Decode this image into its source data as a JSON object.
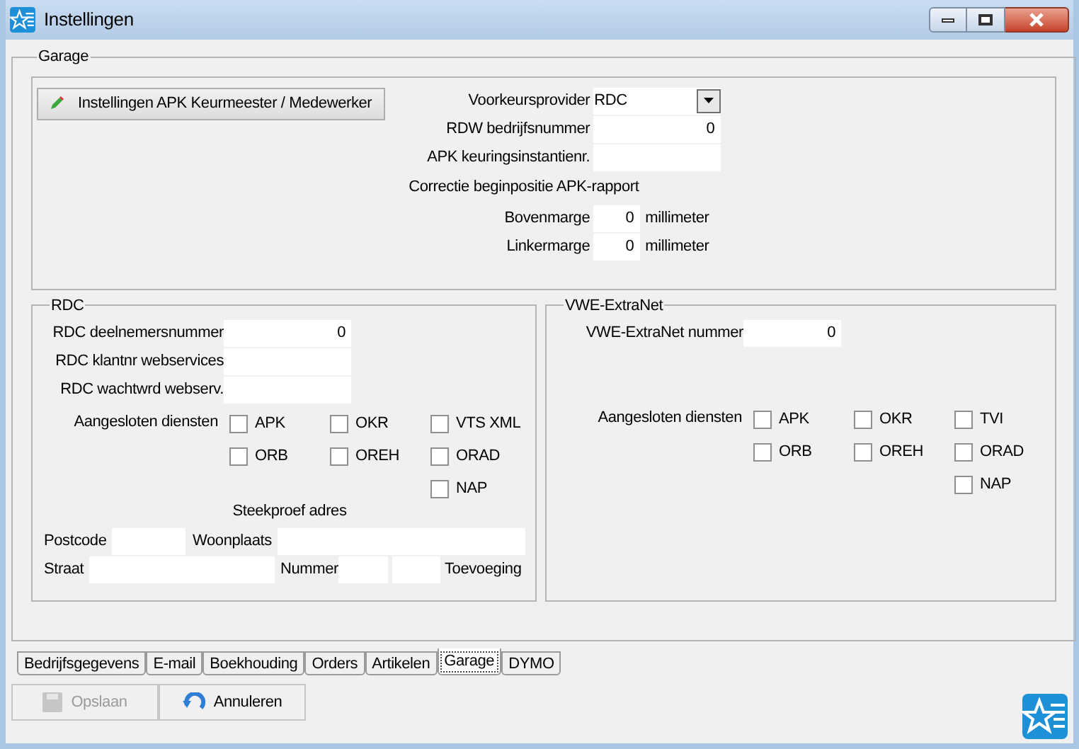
{
  "window": {
    "title": "Instellingen"
  },
  "garage": {
    "title": "Garage",
    "button": "Instellingen APK Keurmeester / Medewerker",
    "provider": {
      "label": "Voorkeursprovider",
      "value": "RDC"
    },
    "fields": [
      {
        "label": "RDW bedrijfsnummer",
        "value": "0"
      },
      {
        "label": "APK keuringsinstantienr."
      }
    ],
    "correction_heading": "Correctie beginpositie APK-rapport",
    "margins": [
      {
        "label": "Bovenmarge",
        "value": "0",
        "unit": "millimeter"
      },
      {
        "label": "Linkermarge",
        "value": "0",
        "unit": "millimeter"
      }
    ]
  },
  "rdc": {
    "title": "RDC",
    "fields": [
      {
        "label": "RDC deelnemersnummer",
        "value": "0"
      },
      {
        "label": "RDC klantnr webservices"
      },
      {
        "label": "RDC wachtwrd webserv."
      }
    ],
    "services_label": "Aangesloten diensten",
    "services": [
      [
        {
          "label": "APK",
          "checked": false
        },
        {
          "label": "ORB",
          "checked": false
        }
      ],
      [
        {
          "label": "OKR",
          "checked": false
        },
        {
          "label": "OREH",
          "checked": false
        }
      ],
      [
        {
          "label": "VTS XML",
          "checked": false
        },
        {
          "label": "ORAD",
          "checked": false
        },
        {
          "label": "NAP",
          "checked": false
        }
      ]
    ],
    "sample_heading": "Steekproef adres",
    "postcode": "Postcode",
    "woonplaats": "Woonplaats",
    "straat": "Straat",
    "nummer": "Nummer",
    "toevoeging": "Toevoeging"
  },
  "vwe": {
    "title": "VWE-ExtraNet",
    "field": {
      "label": "VWE-ExtraNet nummer",
      "value": "0"
    },
    "services_label": "Aangesloten diensten",
    "services": [
      [
        {
          "label": "APK",
          "checked": false
        },
        {
          "label": "ORB",
          "checked": false
        }
      ],
      [
        {
          "label": "OKR",
          "checked": false
        },
        {
          "label": "OREH",
          "checked": false
        }
      ],
      [
        {
          "label": "TVI",
          "checked": false
        },
        {
          "label": "ORAD",
          "checked": false
        },
        {
          "label": "NAP",
          "checked": false
        }
      ]
    ]
  },
  "tabs": [
    {
      "label": "Bedrijfsgegevens",
      "selected": false
    },
    {
      "label": "E-mail",
      "selected": false
    },
    {
      "label": "Boekhouding",
      "selected": false
    },
    {
      "label": "Orders",
      "selected": false
    },
    {
      "label": "Artikelen",
      "selected": false
    },
    {
      "label": "Garage",
      "selected": true
    },
    {
      "label": "DYMO",
      "selected": false
    }
  ],
  "buttons": [
    {
      "label": "Opslaan",
      "disabled": true,
      "kind": "save"
    },
    {
      "label": "Annuleren",
      "disabled": false,
      "kind": "cancel"
    }
  ]
}
